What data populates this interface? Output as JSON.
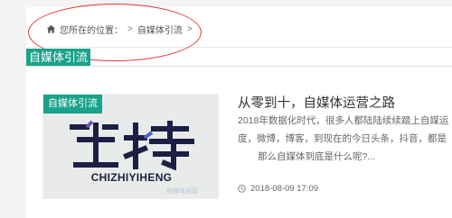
{
  "breadcrumb": {
    "prefix": "您所在的位置：",
    "separator": ">",
    "current": "自媒体引流",
    "trailing": ">"
  },
  "category": {
    "tag": "自媒体引流"
  },
  "article": {
    "thumb_badge": "自媒体引流",
    "thumb_subtitle": "CHIZHIYIHENG",
    "thumb_watermark": "自媒体运营",
    "title": "从零到十，自媒体运营之路",
    "excerpt_lines": [
      "2018年数据化时代，很多人都陆陆续续踏上自媒运",
      "度，微博，博客，到现在的今日头条，抖音，都是",
      "那么自媒体到底是什么呢?..."
    ],
    "date": "2018-08-09 17:09"
  },
  "colors": {
    "accent": "#18a38a",
    "annotation": "#e33a3a"
  },
  "icons": {
    "home": "home-icon",
    "clock": "clock-icon"
  }
}
